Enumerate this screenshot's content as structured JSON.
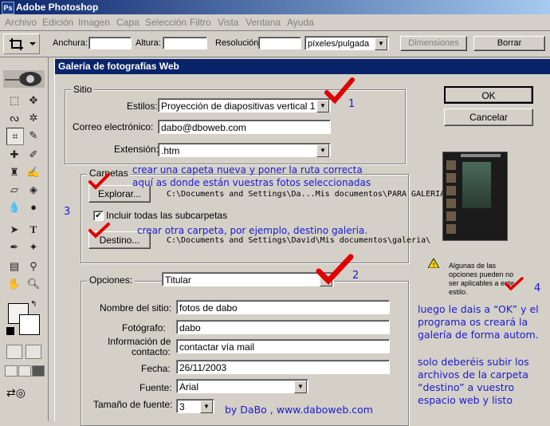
{
  "app": {
    "title": "Adobe Photoshop",
    "icon": "photoshop-icon"
  },
  "menu": [
    "Archivo",
    "Edición",
    "Imagen",
    "Capa",
    "Selección",
    "Filtro",
    "Vista",
    "Ventana",
    "Ayuda"
  ],
  "options_bar": {
    "width_label": "Anchura:",
    "width_value": "",
    "height_label": "Altura:",
    "height_value": "",
    "resolution_label": "Resolución:",
    "resolution_value": "",
    "resolution_unit": "píxeles/pulgada",
    "dimensions_button": "Dimensiones",
    "clear_button": "Borrar"
  },
  "dialog": {
    "title": "Galería de fotografías Web",
    "ok": "OK",
    "cancel": "Cancelar",
    "site": {
      "group_label": "Sitio",
      "styles_label": "Estilos:",
      "styles_value": "Proyección de diapositivas vertical 1",
      "email_label": "Correo electrónico:",
      "email_value": "dabo@dboweb.com",
      "extension_label": "Extensión:",
      "extension_value": ".htm"
    },
    "folders": {
      "group_label": "Carpetas",
      "browse_button": "Explorar...",
      "source_path": "C:\\Documents and Settings\\Da...Mis documentos\\PARA GALERIA\\",
      "include_subfolders": "Incluir todas las subcarpetas",
      "include_checked": true,
      "destination_button": "Destino...",
      "destination_path": "C:\\Documents and Settings\\David\\Mis documentos\\galeria\\"
    },
    "options": {
      "label": "Opciones:",
      "value": "Titular",
      "site_name_label": "Nombre del sitio:",
      "site_name_value": "fotos de dabo",
      "photographer_label": "Fotógrafo:",
      "photographer_value": "dabo",
      "contact_label_1": "Información de",
      "contact_label_2": "contacto:",
      "contact_value": "contactar vía mail",
      "date_label": "Fecha:",
      "date_value": "26/11/2003",
      "font_label": "Fuente:",
      "font_value": "Arial",
      "font_size_label": "Tamaño de fuente:",
      "font_size_value": "3"
    },
    "warning": {
      "icon": "warning-icon",
      "lines": [
        "Algunas de las",
        "opciones pueden no",
        "ser aplicables a este",
        "estilo."
      ]
    }
  },
  "annotations": {
    "n1": "1",
    "n2": "2",
    "n3": "3",
    "n4": "4",
    "folders_tip_1": "crear una capeta nueva y poner la ruta correcta",
    "folders_tip_2": "aquí as donde están vuestras fotos seleccionadas",
    "destination_tip": "crear otra carpeta, por ejemplo, destino galeria.",
    "ok_tip": [
      "luego le dais a “OK” y el",
      "programa os creará la",
      "galería de forma autom."
    ],
    "upload_tip": [
      "solo deberéis subir los",
      "archivos de la carpeta",
      "“destino” a vuestro",
      "espacio web y listo"
    ],
    "credit": "by DaBo , www.daboweb.com",
    "check_color": "#e00000",
    "text_color": "#1a1ad0"
  }
}
